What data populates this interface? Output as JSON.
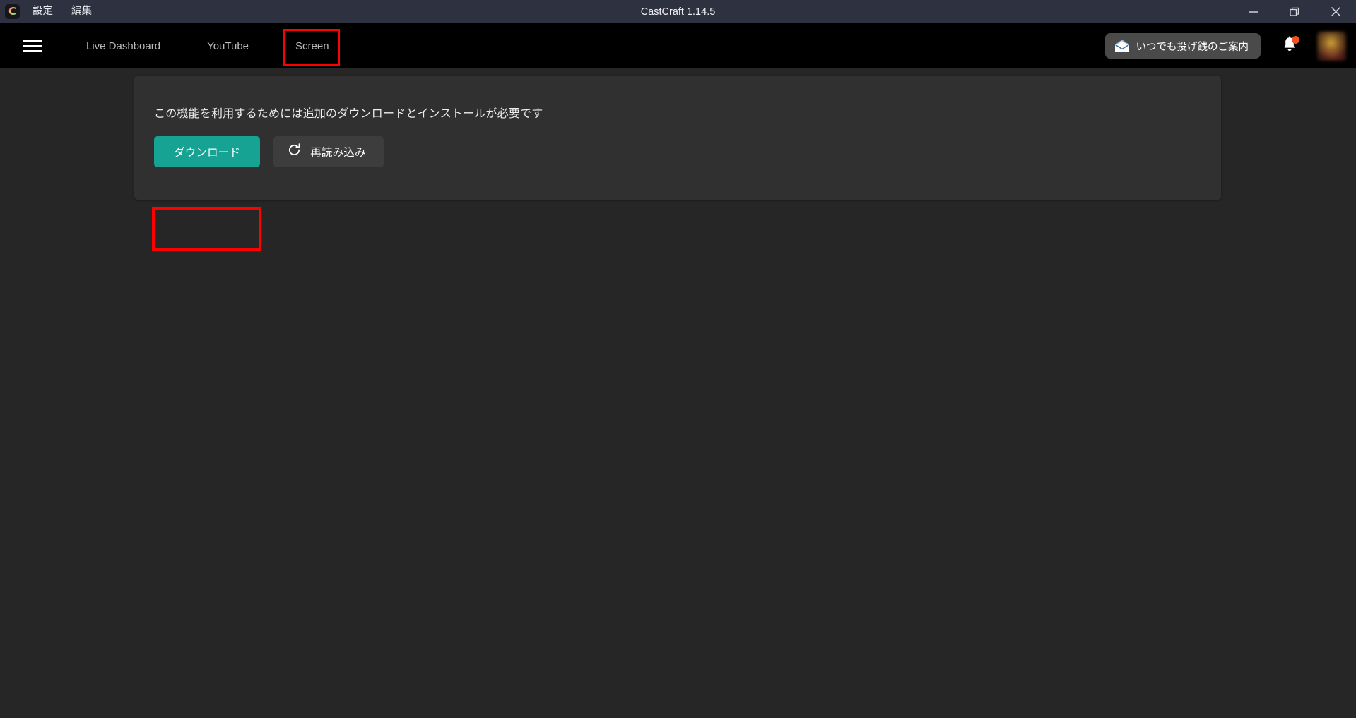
{
  "titlebar": {
    "logo_icon": "castcraft-logo-icon",
    "logo_glyph": "C",
    "menus": [
      {
        "label": "設定",
        "name": "menu-settings"
      },
      {
        "label": "編集",
        "name": "menu-edit"
      }
    ],
    "title": "CastCraft 1.14.5",
    "window_controls": [
      {
        "name": "minimize-icon",
        "label": "—"
      },
      {
        "name": "maximize-icon",
        "label": "❐"
      },
      {
        "name": "close-icon",
        "label": "✕"
      }
    ]
  },
  "navbar": {
    "menu_icon": "hamburger-menu-icon",
    "links": [
      {
        "label": "Live Dashboard",
        "name": "nav-link-live-dashboard"
      },
      {
        "label": "YouTube",
        "name": "nav-link-youtube"
      },
      {
        "label": "Screen",
        "name": "nav-link-screen"
      }
    ],
    "active_link": "Screen",
    "tip_button": {
      "label": "いつでも投げ銭のご案内",
      "icon": "open-envelope-icon"
    },
    "notification": {
      "icon": "bell-icon",
      "has_unread": true,
      "dot_color": "#f4511e"
    },
    "avatar": {
      "name": "user-avatar"
    }
  },
  "main": {
    "panel": {
      "message": "この機能を利用するためには追加のダウンロードとインストールが必要です",
      "download_button": {
        "label": "ダウンロード",
        "color": "#16a394"
      },
      "reload_button": {
        "label": "再読み込み",
        "icon": "refresh-icon",
        "color": "#3d3d3d"
      }
    }
  },
  "annotations": {
    "highlight_color": "#ff0000",
    "highlighted_elements": [
      "Screen",
      "ダウンロード"
    ]
  }
}
